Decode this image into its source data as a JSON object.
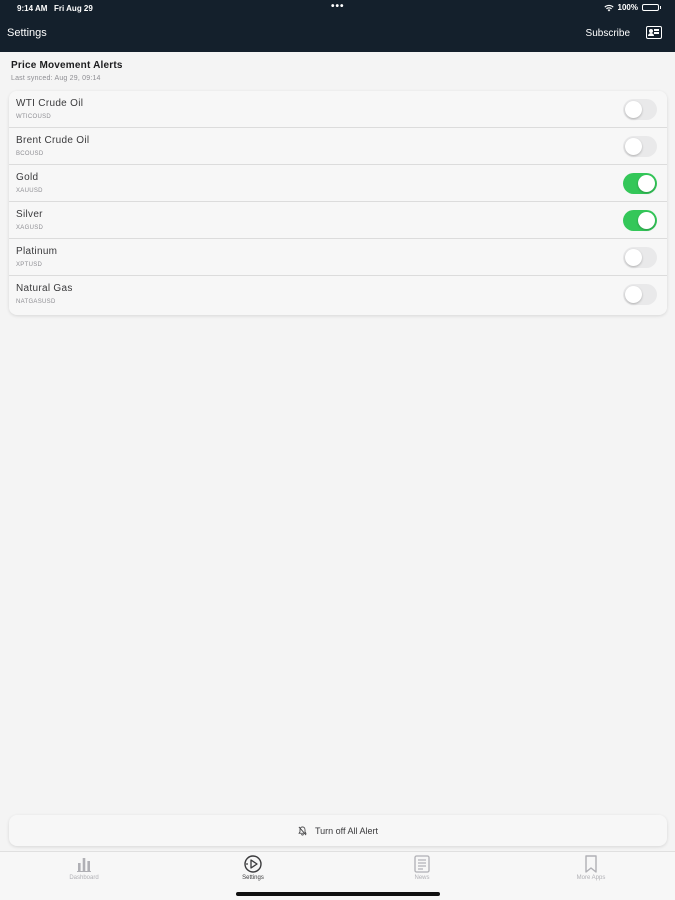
{
  "status_bar": {
    "time": "9:14 AM",
    "date": "Fri Aug 29",
    "dots": "•••",
    "battery": "100%",
    "icons": [
      "wifi-icon",
      "battery-icon"
    ]
  },
  "nav": {
    "title": "Settings",
    "subscribe_label": "Subscribe",
    "profile_icon": "profile-card-icon"
  },
  "section": {
    "title": "Price Movement Alerts",
    "last_synced": "Last synced: Aug 29, 09:14"
  },
  "alerts": [
    {
      "name": "WTI Crude Oil",
      "symbol": "WTICOUSD",
      "enabled": false
    },
    {
      "name": "Brent Crude Oil",
      "symbol": "BCOUSD",
      "enabled": false
    },
    {
      "name": "Gold",
      "symbol": "XAUUSD",
      "enabled": true
    },
    {
      "name": "Silver",
      "symbol": "XAGUSD",
      "enabled": true
    },
    {
      "name": "Platinum",
      "symbol": "XPTUSD",
      "enabled": false
    },
    {
      "name": "Natural Gas",
      "symbol": "NATGASUSD",
      "enabled": false
    }
  ],
  "turn_off_all": {
    "label": "Turn off All Alert",
    "icon": "bell-slash-icon"
  },
  "tabs": [
    {
      "label": "Dashboard",
      "icon": "bar-chart-icon",
      "active": false
    },
    {
      "label": "Settings",
      "icon": "settings-gauge-icon",
      "active": true
    },
    {
      "label": "News",
      "icon": "newspaper-icon",
      "active": false
    },
    {
      "label": "More Apps",
      "icon": "bookmark-icon",
      "active": false
    }
  ],
  "colors": {
    "header_bg": "#14202c",
    "toggle_on": "#34c759",
    "toggle_off": "#e9e9ea",
    "page_bg": "#f4f4f4"
  }
}
